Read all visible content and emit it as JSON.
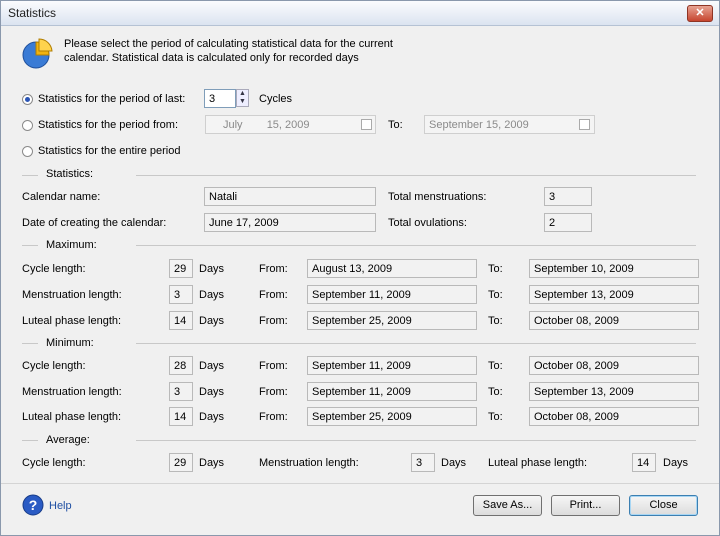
{
  "window": {
    "title": "Statistics",
    "close": "✕"
  },
  "intro": {
    "line1": "Please select the period of calculating statistical data for the current",
    "line2": "calendar. Statistical data is calculated only for recorded days"
  },
  "period": {
    "last_label": "Statistics for the period of last:",
    "last_value": "3",
    "last_unit": "Cycles",
    "from_label": "Statistics for the period from:",
    "from_month": "July",
    "from_day": "15, 2009",
    "to_label": "To:",
    "to_value": "September 15, 2009",
    "entire_label": "Statistics for the entire period"
  },
  "statistics": {
    "section": "Statistics:",
    "calendar_name_label": "Calendar name:",
    "calendar_name": "Natali",
    "created_label": "Date of creating the calendar:",
    "created": "June 17, 2009",
    "total_menstruations_label": "Total menstruations:",
    "total_menstruations": "3",
    "total_ovulations_label": "Total ovulations:",
    "total_ovulations": "2"
  },
  "labels": {
    "days": "Days",
    "from": "From:",
    "to": "To:"
  },
  "maximum": {
    "section": "Maximum:",
    "rows": [
      {
        "label": "Cycle length:",
        "value": "29",
        "from": "August 13, 2009",
        "to": "September 10, 2009"
      },
      {
        "label": "Menstruation length:",
        "value": "3",
        "from": "September 11, 2009",
        "to": "September 13, 2009"
      },
      {
        "label": "Luteal phase length:",
        "value": "14",
        "from": "September 25, 2009",
        "to": "October 08, 2009"
      }
    ]
  },
  "minimum": {
    "section": "Minimum:",
    "rows": [
      {
        "label": "Cycle length:",
        "value": "28",
        "from": "September 11, 2009",
        "to": "October 08, 2009"
      },
      {
        "label": "Menstruation length:",
        "value": "3",
        "from": "September 11, 2009",
        "to": "September 13, 2009"
      },
      {
        "label": "Luteal phase length:",
        "value": "14",
        "from": "September 25, 2009",
        "to": "October 08, 2009"
      }
    ]
  },
  "average": {
    "section": "Average:",
    "cycle_label": "Cycle length:",
    "cycle_value": "29",
    "menstruation_label": "Menstruation length:",
    "menstruation_value": "3",
    "luteal_label": "Luteal phase length:",
    "luteal_value": "14"
  },
  "footer": {
    "help": "Help",
    "save": "Save As...",
    "print": "Print...",
    "close": "Close"
  },
  "icons": {
    "chart": "pie-chart-icon",
    "help": "help-icon",
    "calendar": "calendar-icon"
  },
  "colors": {
    "accent": "#2b55b5",
    "help_icon": "#2a5bc4",
    "pie": "#f2b30f"
  }
}
